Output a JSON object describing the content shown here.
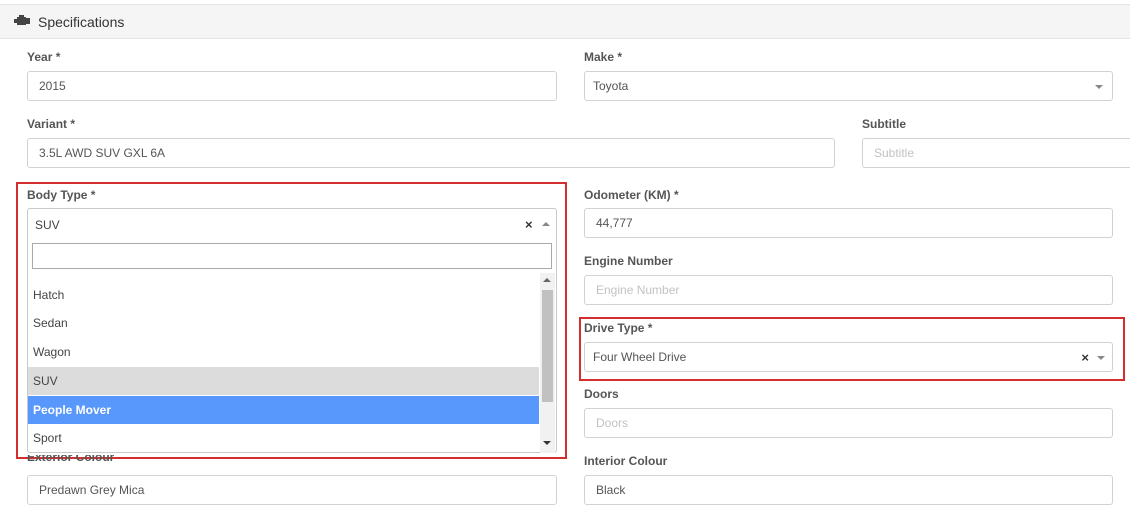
{
  "header": {
    "title": "Specifications",
    "icon": "engine-icon"
  },
  "fields": {
    "year": {
      "label": "Year *",
      "value": "2015"
    },
    "make": {
      "label": "Make *",
      "value": "Toyota"
    },
    "variant": {
      "label": "Variant *",
      "value": "3.5L AWD SUV GXL 6A"
    },
    "subtitle": {
      "label": "Subtitle",
      "placeholder": "Subtitle"
    },
    "body_type": {
      "label": "Body Type *",
      "value": "SUV",
      "options": [
        "Hatch",
        "Sedan",
        "Wagon",
        "SUV",
        "People Mover",
        "Sport"
      ],
      "hovered": "SUV",
      "highlighted": "People Mover"
    },
    "odometer": {
      "label": "Odometer (KM) *",
      "value": "44,777"
    },
    "engine_number": {
      "label": "Engine Number",
      "placeholder": "Engine Number"
    },
    "drive_type": {
      "label": "Drive Type *",
      "value": "Four Wheel Drive"
    },
    "doors": {
      "label": "Doors",
      "placeholder": "Doors"
    },
    "exterior_colour": {
      "label": "Exterior Colour",
      "value": "Predawn Grey Mica"
    },
    "interior_colour": {
      "label": "Interior Colour",
      "value": "Black"
    }
  },
  "colors": {
    "highlight_border": "#d32f2f",
    "option_active": "#5897fb",
    "option_hover": "#dcdcdc"
  }
}
